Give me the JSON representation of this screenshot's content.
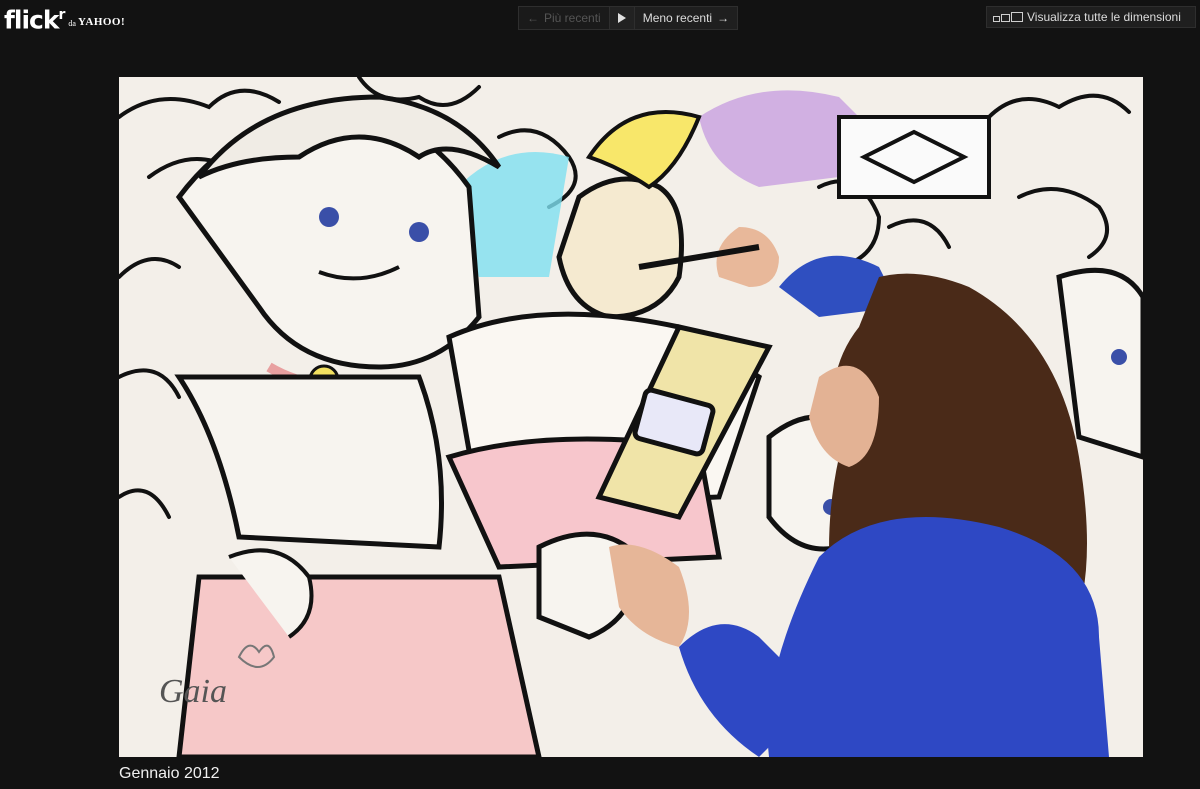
{
  "header": {
    "logo": {
      "word": "flick",
      "r": "r",
      "by": "da",
      "yahoo": "YAHOO!"
    },
    "nav": {
      "prev_label": "Più recenti",
      "next_label": "Meno recenti"
    },
    "view_sizes_label": "Visualizza tutte le dimensioni"
  },
  "photo": {
    "signature": "Gaia",
    "icons": [
      "play-icon",
      "arrow-left-icon",
      "arrow-right-icon",
      "sizes-icon"
    ]
  },
  "caption": "Gennaio 2012"
}
